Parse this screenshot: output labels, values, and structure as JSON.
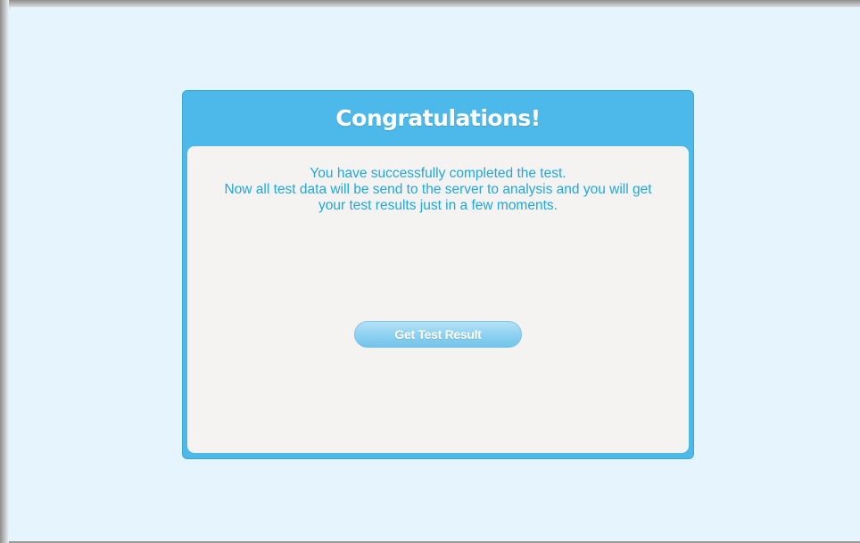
{
  "dialog": {
    "title": "Congratulations!",
    "message_lines": [
      "You have successfully completed the test.",
      "Now all test data will be send to the server to analysis and you will get",
      "your test results just in a few moments."
    ],
    "button_label": "Get Test Result"
  },
  "colors": {
    "background": "#e6f4fd",
    "dialog_header": "#4db9ea",
    "body_panel": "#f4f3f2",
    "message_text": "#1ea8dd",
    "button": "#8fd2f0"
  }
}
